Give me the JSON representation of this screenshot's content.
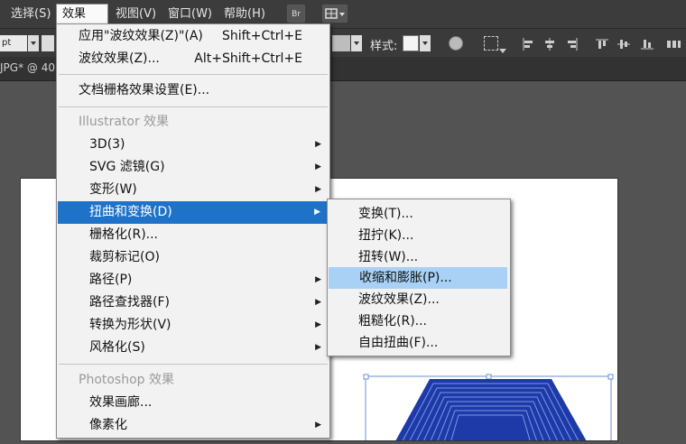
{
  "menubar": {
    "items": [
      "选择(S)",
      "效果(C)",
      "视图(V)",
      "窗口(W)",
      "帮助(H)"
    ],
    "bridge_button": "Br"
  },
  "toolbar": {
    "stroke_unit": "pt",
    "style_label": "样式:"
  },
  "document_tab": {
    "label": "JPG* @ 40"
  },
  "effect_menu": {
    "items": [
      {
        "label": "应用\"波纹效果(Z)\"(A)",
        "shortcut": "Shift+Ctrl+E"
      },
      {
        "label": "波纹效果(Z)...",
        "shortcut": "Alt+Shift+Ctrl+E"
      },
      {
        "label": "文档栅格效果设置(E)..."
      }
    ],
    "illustrator_header": "Illustrator 效果",
    "illustrator_items": [
      {
        "label": "3D(3)",
        "submenu": true
      },
      {
        "label": "SVG 滤镜(G)",
        "submenu": true
      },
      {
        "label": "变形(W)",
        "submenu": true
      },
      {
        "label": "扭曲和变换(D)",
        "submenu": true
      },
      {
        "label": "栅格化(R)...",
        "submenu": false
      },
      {
        "label": "裁剪标记(O)",
        "submenu": false
      },
      {
        "label": "路径(P)",
        "submenu": true
      },
      {
        "label": "路径查找器(F)",
        "submenu": true
      },
      {
        "label": "转换为形状(V)",
        "submenu": true
      },
      {
        "label": "风格化(S)",
        "submenu": true
      }
    ],
    "photoshop_header": "Photoshop 效果",
    "photoshop_items": [
      {
        "label": "效果画廊...",
        "submenu": false
      },
      {
        "label": "像素化",
        "submenu": true
      }
    ]
  },
  "distort_submenu": {
    "items": [
      "变换(T)...",
      "扭拧(K)...",
      "扭转(W)...",
      "收缩和膨胀(P)...",
      "波纹效果(Z)...",
      "粗糙化(R)...",
      "自由扭曲(F)..."
    ]
  },
  "icons": {
    "arrow": "submenu-arrow-icon",
    "dropdown": "dropdown-icon"
  },
  "colors": {
    "highlight": "#1e73c9",
    "submenu_highlight": "#a8d1f5",
    "shape_blue": "#2f4dbb"
  }
}
